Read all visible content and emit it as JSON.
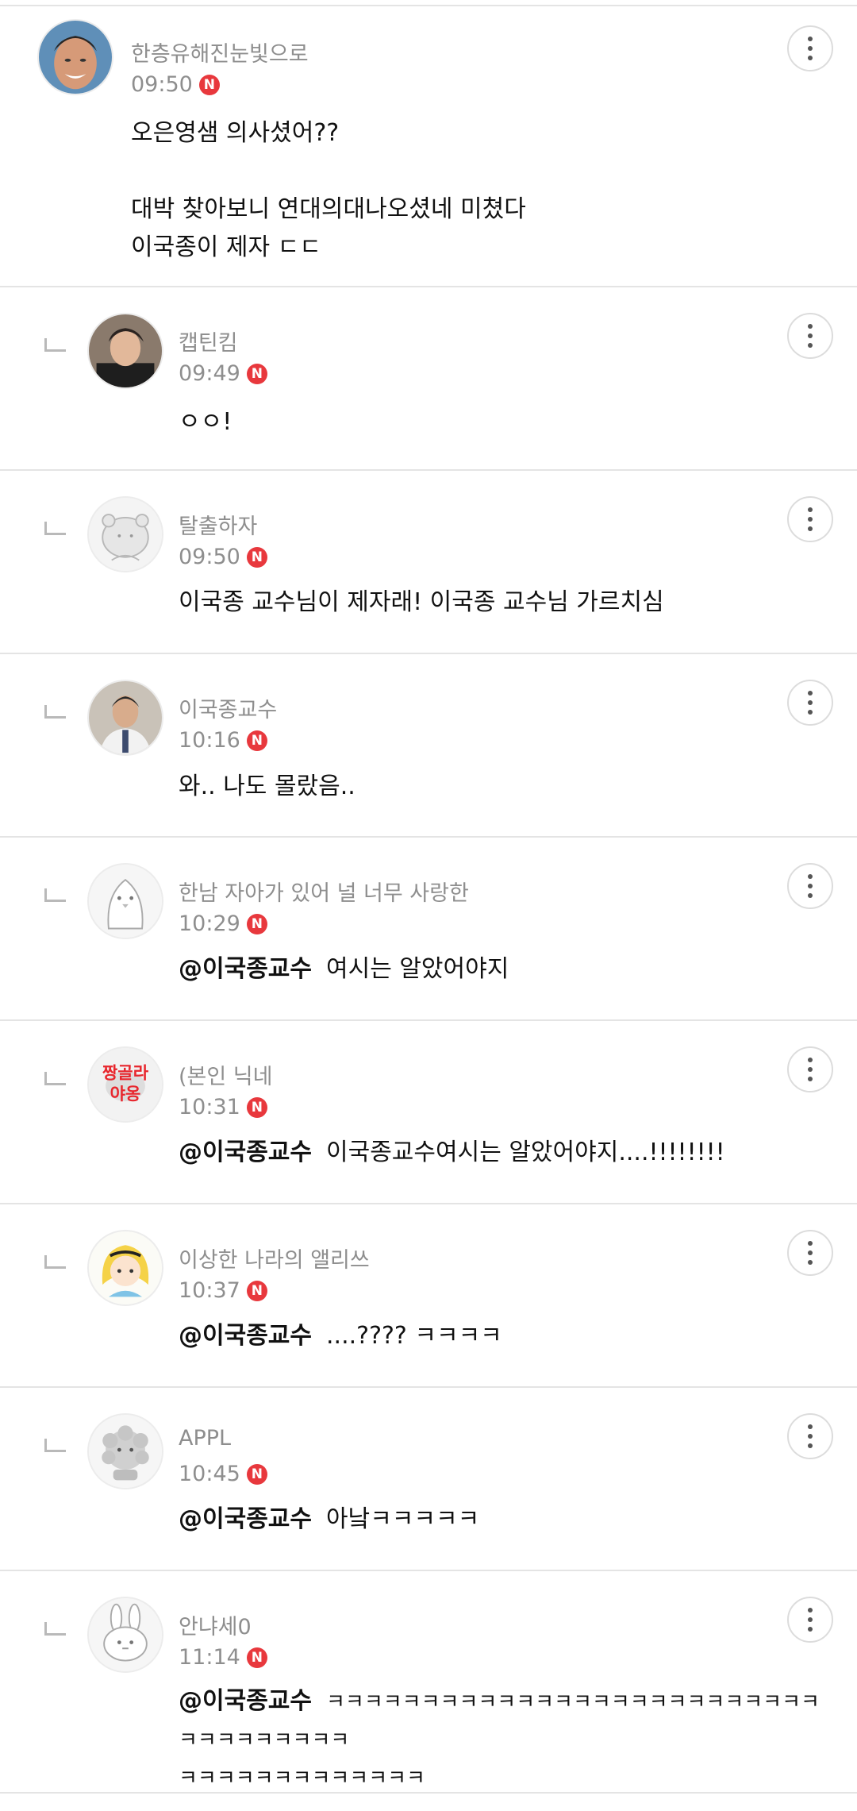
{
  "comments": [
    {
      "author": "한층유해진눈빛으로",
      "time": "09:50",
      "badge": "N",
      "mention": "",
      "text": "오은영샘 의사셨어??\n\n대박 찾아보니 연대의대나오셨네 미쳤다\n이국종이 제자 ㄷㄷ",
      "avatar_icon": "photo-man-smiling-avatar"
    },
    {
      "author": "캡틴킴",
      "time": "09:49",
      "badge": "N",
      "mention": "",
      "text": "ㅇㅇ!",
      "avatar_icon": "photo-man-avatar"
    },
    {
      "author": "탈출하자",
      "time": "09:50",
      "badge": "N",
      "mention": "",
      "text": "이국종 교수님이 제자래! 이국종 교수님 가르치심",
      "avatar_icon": "default-character-avatar"
    },
    {
      "author": "이국종교수",
      "time": "10:16",
      "badge": "N",
      "mention": "",
      "text": "와.. 나도 몰랐음..",
      "avatar_icon": "photo-doctor-avatar"
    },
    {
      "author": "한남 자아가 있어 널 너무 사랑한",
      "time": "10:29",
      "badge": "N",
      "mention": "@이국종교수",
      "text": "여시는 알았어야지",
      "avatar_icon": "penguin-character-avatar"
    },
    {
      "author": "(본인 닉네",
      "time": "10:31",
      "badge": "N",
      "mention": "@이국종교수",
      "text": "이국종교수여시는 알았어야지....!!!!!!!!",
      "avatar_icon": "sticker-text-avatar",
      "avatar_text": [
        "짱골라",
        "야옹"
      ]
    },
    {
      "author": "이상한 나라의 앨리쓰",
      "time": "10:37",
      "badge": "N",
      "mention": "@이국종교수",
      "text": "....???? ㅋㅋㅋㅋ",
      "avatar_icon": "alice-cartoon-avatar"
    },
    {
      "author": "APPL",
      "time": "10:45",
      "badge": "N",
      "mention": "@이국종교수",
      "text": "아낰ㅋㅋㅋㅋㅋ",
      "avatar_icon": "fluffy-dog-avatar"
    },
    {
      "author": "안냐세0",
      "time": "11:14",
      "badge": "N",
      "mention": "@이국종교수",
      "text": "ㅋㅋㅋㅋㅋㅋㅋㅋㅋㅋㅋㅋㅋㅋㅋㅋㅋㅋㅋㅋㅋㅋㅋㅋㅋㅋㅋㅋㅋㅋㅋㅋㅋㅋㅋ\nㅋㅋㅋㅋㅋㅋㅋㅋㅋㅋㅋㅋㅋ",
      "avatar_icon": "bunny-character-avatar"
    }
  ]
}
